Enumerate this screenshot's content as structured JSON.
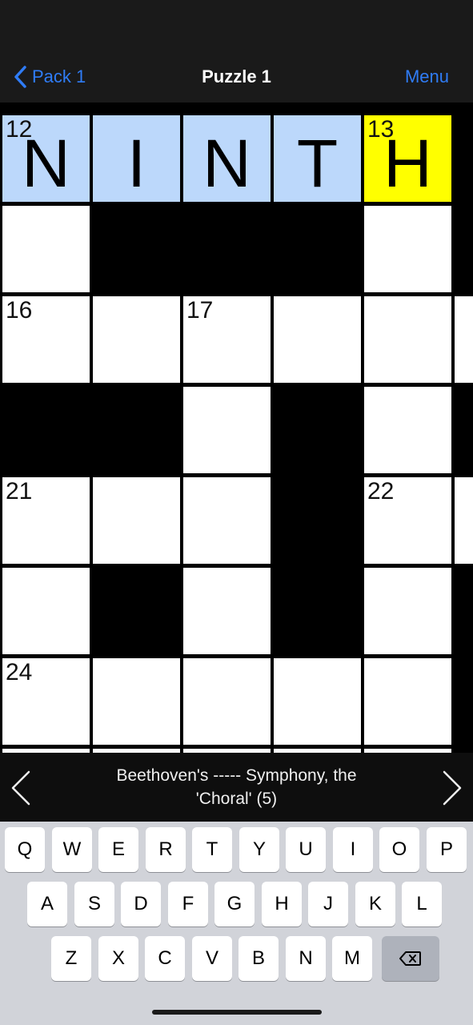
{
  "nav": {
    "back_label": "Pack 1",
    "title": "Puzzle 1",
    "menu_label": "Menu"
  },
  "colors": {
    "accent": "#2f7cf6",
    "highlight": "#bcd8fb",
    "active": "#ffff00",
    "block": "#000000",
    "empty": "#ffffff"
  },
  "grid": {
    "rows": [
      [
        {
          "type": "hl",
          "num": "12",
          "letter": "N"
        },
        {
          "type": "hl",
          "num": "",
          "letter": "I"
        },
        {
          "type": "hl",
          "num": "",
          "letter": "N"
        },
        {
          "type": "hl",
          "num": "",
          "letter": "T"
        },
        {
          "type": "active",
          "num": "13",
          "letter": "H"
        }
      ],
      [
        {
          "type": "white",
          "num": "",
          "letter": ""
        },
        {
          "type": "black",
          "num": "",
          "letter": ""
        },
        {
          "type": "black",
          "num": "",
          "letter": ""
        },
        {
          "type": "black",
          "num": "",
          "letter": ""
        },
        {
          "type": "white",
          "num": "",
          "letter": ""
        }
      ],
      [
        {
          "type": "white",
          "num": "16",
          "letter": ""
        },
        {
          "type": "white",
          "num": "",
          "letter": ""
        },
        {
          "type": "white",
          "num": "17",
          "letter": ""
        },
        {
          "type": "white",
          "num": "",
          "letter": ""
        },
        {
          "type": "white",
          "num": "",
          "letter": ""
        }
      ],
      [
        {
          "type": "black",
          "num": "",
          "letter": ""
        },
        {
          "type": "black",
          "num": "",
          "letter": ""
        },
        {
          "type": "white",
          "num": "",
          "letter": ""
        },
        {
          "type": "black",
          "num": "",
          "letter": ""
        },
        {
          "type": "white",
          "num": "",
          "letter": ""
        }
      ],
      [
        {
          "type": "white",
          "num": "21",
          "letter": ""
        },
        {
          "type": "white",
          "num": "",
          "letter": ""
        },
        {
          "type": "white",
          "num": "",
          "letter": ""
        },
        {
          "type": "black",
          "num": "",
          "letter": ""
        },
        {
          "type": "white",
          "num": "22",
          "letter": ""
        }
      ],
      [
        {
          "type": "white",
          "num": "",
          "letter": ""
        },
        {
          "type": "black",
          "num": "",
          "letter": ""
        },
        {
          "type": "white",
          "num": "",
          "letter": ""
        },
        {
          "type": "black",
          "num": "",
          "letter": ""
        },
        {
          "type": "white",
          "num": "",
          "letter": ""
        }
      ],
      [
        {
          "type": "white",
          "num": "24",
          "letter": ""
        },
        {
          "type": "white",
          "num": "",
          "letter": ""
        },
        {
          "type": "white",
          "num": "",
          "letter": ""
        },
        {
          "type": "white",
          "num": "",
          "letter": ""
        },
        {
          "type": "white",
          "num": "",
          "letter": ""
        }
      ]
    ],
    "right_edge": [
      "black",
      "black",
      "white",
      "black",
      "white",
      "black",
      "black"
    ]
  },
  "clue": {
    "line1": "Beethoven's ----- Symphony, the",
    "line2": "'Choral' (5)",
    "prev_icon": "chevron-left-icon",
    "next_icon": "chevron-right-icon"
  },
  "keyboard": {
    "row1": [
      "Q",
      "W",
      "E",
      "R",
      "T",
      "Y",
      "U",
      "I",
      "O",
      "P"
    ],
    "row2": [
      "A",
      "S",
      "D",
      "F",
      "G",
      "H",
      "J",
      "K",
      "L"
    ],
    "row3": [
      "Z",
      "X",
      "C",
      "V",
      "B",
      "N",
      "M"
    ],
    "delete_icon": "backspace-icon"
  }
}
